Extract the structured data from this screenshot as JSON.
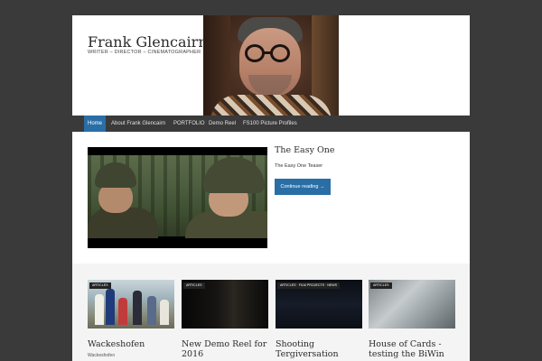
{
  "site": {
    "title": "Frank Glencairn",
    "description": "WRITER – DIRECTOR – CINEMATOGRAPHER"
  },
  "nav": {
    "items": [
      {
        "label": "Home",
        "active": true
      },
      {
        "label": "About Frank Glencairn",
        "active": false
      },
      {
        "label": "PORTFOLIO",
        "active": false
      },
      {
        "label": "Demo Reel",
        "active": false
      },
      {
        "label": "FS100 Picture Profiles",
        "active": false
      }
    ]
  },
  "featured": {
    "title": "The Easy One",
    "excerpt": "The Easy One Teaser",
    "more_label": "Continue reading →"
  },
  "cards": [
    {
      "category": "ARTICLES",
      "title": "Wackeshofen",
      "sub": "Wackeshofen"
    },
    {
      "category": "ARTICLES",
      "title": "New Demo Reel for 2016",
      "sub": ""
    },
    {
      "category": "ARTICLES · FILM PROJECTS · NEWS",
      "title": "Shooting Tergiversation",
      "sub": ""
    },
    {
      "category": "ARTICLES",
      "title": "House of Cards - testing the BiWin",
      "sub": ""
    }
  ],
  "colors": {
    "accent": "#2a6ea6",
    "page_bg": "#3a3a3a",
    "nav_bg": "#3a3a3a"
  }
}
